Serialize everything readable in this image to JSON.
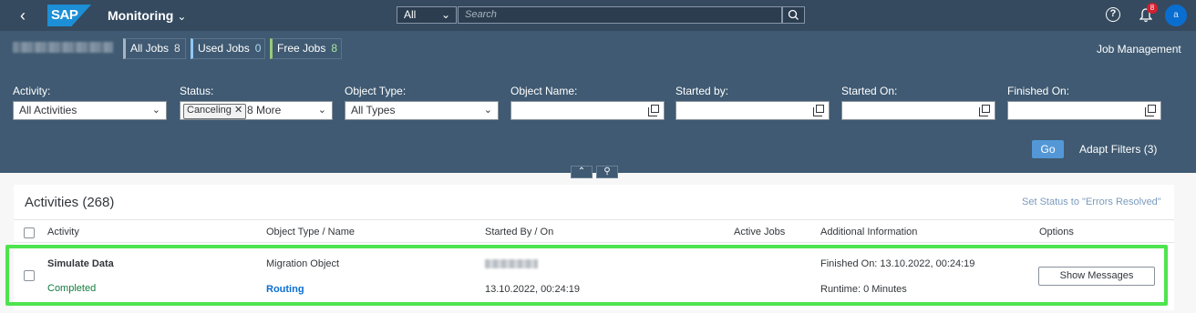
{
  "shell": {
    "app_title": "Monitoring",
    "logo": "SAP",
    "search_scope": "All",
    "search_placeholder": "Search",
    "notification_count": "8",
    "avatar_initial": "a"
  },
  "header": {
    "chips": [
      {
        "label": "All Jobs",
        "count": "8"
      },
      {
        "label": "Used Jobs",
        "count": "0"
      },
      {
        "label": "Free Jobs",
        "count": "8"
      }
    ],
    "job_management": "Job Management"
  },
  "filters": {
    "activity_label": "Activity:",
    "activity_value": "All Activities",
    "status_label": "Status:",
    "status_token": "Canceling",
    "status_more": "8 More",
    "object_type_label": "Object Type:",
    "object_type_value": "All Types",
    "object_name_label": "Object Name:",
    "started_by_label": "Started by:",
    "started_on_label": "Started On:",
    "finished_on_label": "Finished On:",
    "go": "Go",
    "adapt_filters": "Adapt Filters (3)"
  },
  "table": {
    "title": "Activities (268)",
    "set_status": "Set Status to \"Errors Resolved\"",
    "columns": [
      "Activity",
      "Object Type / Name",
      "Started By / On",
      "Active Jobs",
      "Additional Information",
      "Options"
    ],
    "rows": [
      {
        "activity": "Simulate Data",
        "status": "Completed",
        "object_type": "Migration Object",
        "object_name": "Routing",
        "started_on": "13.10.2022, 00:24:19",
        "finished_on": "Finished On: 13.10.2022, 00:24:19",
        "runtime": "Runtime: 0 Minutes",
        "action": "Show Messages"
      }
    ]
  },
  "colors": {
    "shell_bg": "#354a5f",
    "header_bg": "#3f5a72",
    "accent": "#0a6ed1",
    "success": "#107e3e",
    "highlight": "#4ee44e"
  }
}
